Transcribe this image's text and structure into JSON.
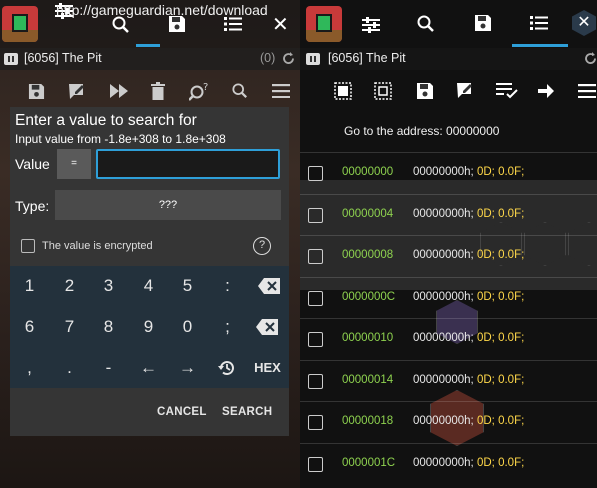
{
  "left": {
    "url": "http://gameguardian.net/download",
    "process": "[6056] The Pit",
    "counter": "(0)",
    "dialog": {
      "title": "Enter a value to search for",
      "subtitle": "Input value from -1.8e+308 to 1.8e+308",
      "value_label": "Value",
      "eq_label": "=",
      "value_input": "",
      "type_label": "Type:",
      "type_value": "???",
      "encrypted_label": "The value is encrypted",
      "help_label": "?",
      "keys": {
        "row1": [
          "1",
          "2",
          "3",
          "4",
          "5",
          ":"
        ],
        "row2": [
          "6",
          "7",
          "8",
          "9",
          "0",
          ";"
        ],
        "row3": [
          ",",
          ".",
          "-",
          "←",
          "→"
        ],
        "hex": "HEX"
      },
      "cancel": "CANCEL",
      "search": "SEARCH"
    }
  },
  "right": {
    "process": "[6056] The Pit",
    "goto": "Go to the address: 00000000",
    "rows": [
      {
        "addr": "00000000",
        "hex": "00000000h;",
        "d": "0D;",
        "f": "0.0F;"
      },
      {
        "addr": "00000004",
        "hex": "00000000h;",
        "d": "0D;",
        "f": "0.0F;"
      },
      {
        "addr": "00000008",
        "hex": "00000000h;",
        "d": "0D;",
        "f": "0.0F;"
      },
      {
        "addr": "0000000C",
        "hex": "00000000h;",
        "d": "0D;",
        "f": "0.0F;"
      },
      {
        "addr": "00000010",
        "hex": "00000000h;",
        "d": "0D;",
        "f": "0.0F;"
      },
      {
        "addr": "00000014",
        "hex": "00000000h;",
        "d": "0D;",
        "f": "0.0F;"
      },
      {
        "addr": "00000018",
        "hex": "00000000h;",
        "d": "0D;",
        "f": "0.0F;"
      },
      {
        "addr": "0000001C",
        "hex": "00000000h;",
        "d": "0D;",
        "f": "0.0F;"
      }
    ]
  },
  "colors": {
    "accent": "#2e9fd8",
    "address": "#8ed24f",
    "number": "#ffd84a",
    "dialog_bg": "#353535",
    "keypad_bg": "#23313c"
  },
  "icons": [
    "game-icon",
    "settings-sliders-icon",
    "search-icon",
    "save-icon",
    "list-icon",
    "close-icon",
    "pause-icon",
    "refresh-icon",
    "edit-icon",
    "fast-forward-icon",
    "delete-icon",
    "search-question-icon",
    "menu-icon",
    "backspace-icon",
    "history-icon",
    "select-all-icon",
    "select-box-icon",
    "list-check-icon",
    "arrow-right-icon"
  ]
}
